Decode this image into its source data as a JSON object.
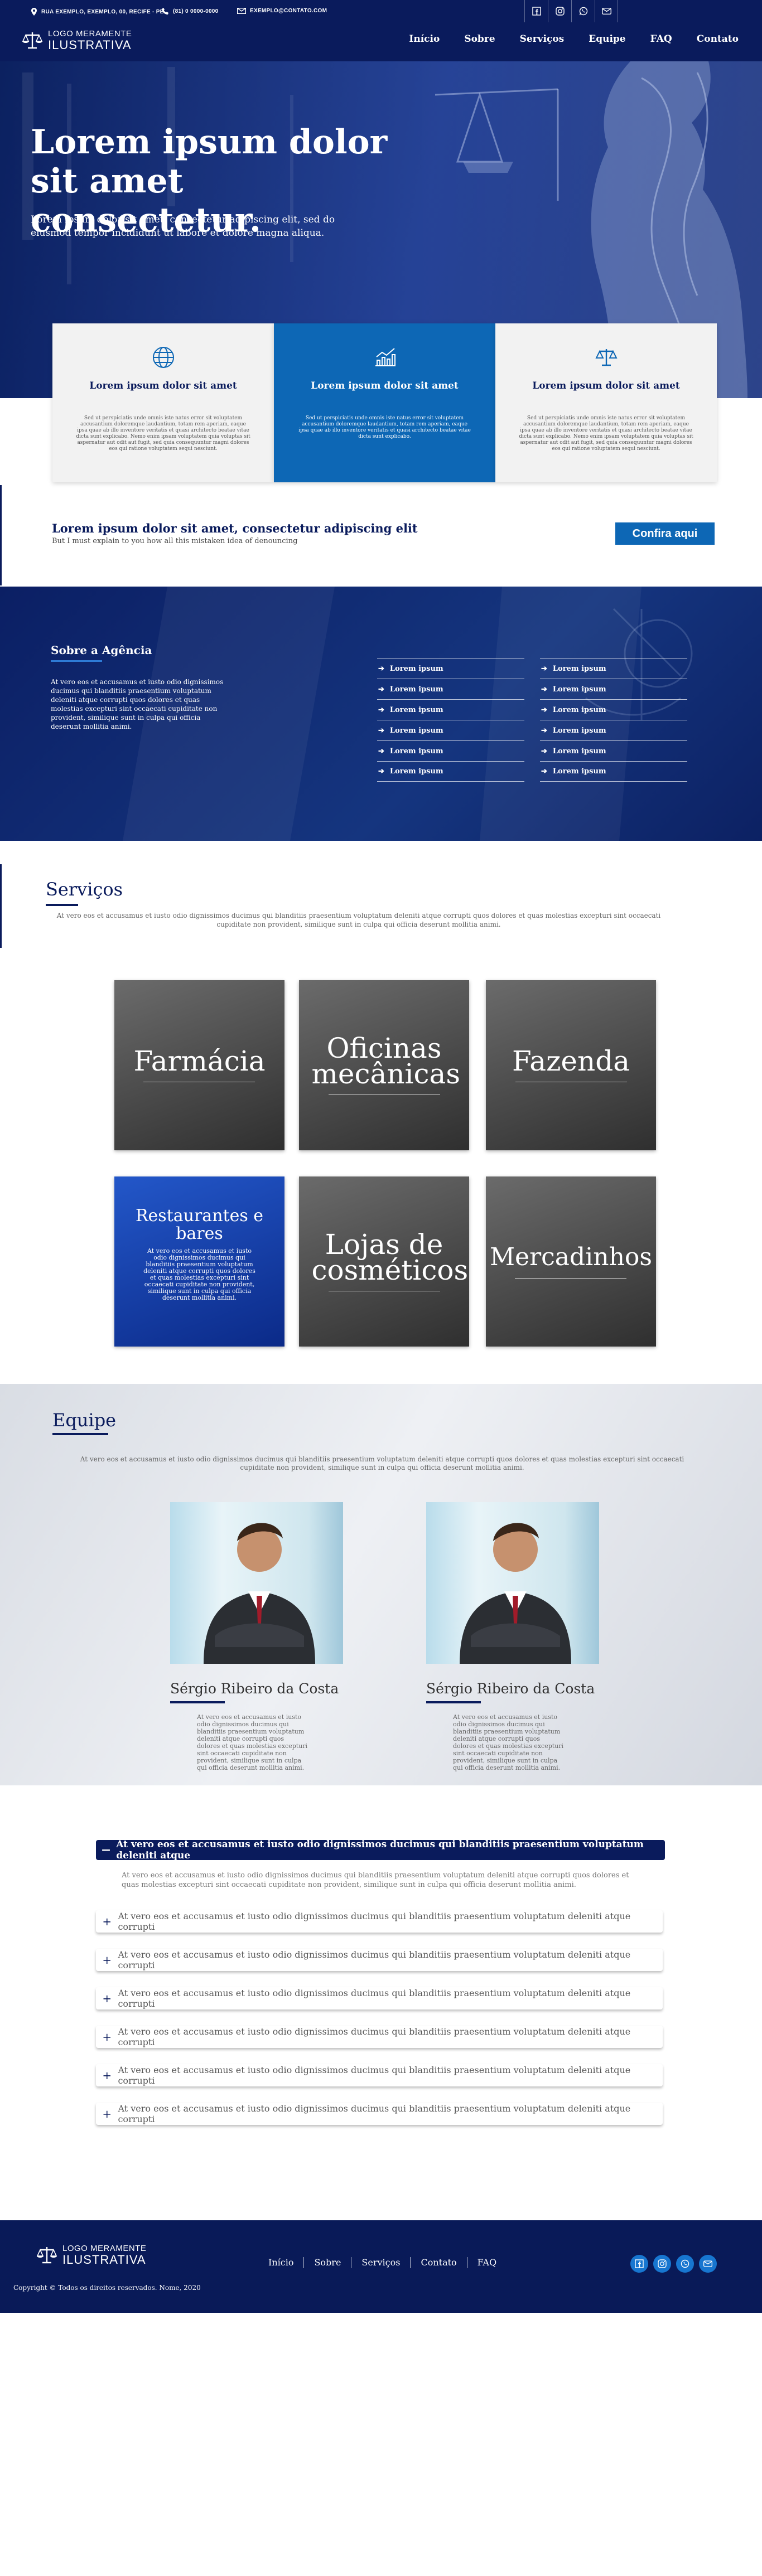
{
  "topbar": {
    "address": "RUA EXEMPLO, EXEMPLO, 00, RECIFE - PE",
    "phone": "(81) 0 0000-0000",
    "email": "EXEMPLO@CONTATO.COM",
    "social_icons": [
      "facebook-icon",
      "instagram-icon",
      "whatsapp-icon",
      "mail-icon"
    ]
  },
  "header": {
    "logo_line1": "LOGO MERAMENTE",
    "logo_line2": "ILUSTRATIVA",
    "nav": [
      "Início",
      "Sobre",
      "Serviços",
      "Equipe",
      "FAQ",
      "Contato"
    ]
  },
  "hero": {
    "title": "Lorem ipsum dolor sit amet consectetur.",
    "subtitle": "Lorem ipsum dolor sit amet, consectetur adipiscing elit, sed do eiusmod tempor incididunt ut labore et dolore magna aliqua."
  },
  "features": [
    {
      "icon": "globe-icon",
      "title": "Lorem ipsum dolor sit amet",
      "text": "Sed ut perspiciatis unde omnis iste natus error sit voluptatem accusantium doloremque laudantium, totam rem aperiam, eaque ipsa quae ab illo inventore veritatis et quasi architecto beatae vitae dicta sunt explicabo. Nemo enim ipsam voluptatem quia voluptas sit aspernatur aut odit aut fugit, sed quia consequuntur magni dolores eos qui ratione voluptatem sequi nesciunt."
    },
    {
      "icon": "chart-icon",
      "title": "Lorem ipsum dolor sit amet",
      "text": "Sed ut perspiciatis unde omnis iste natus error sit voluptatem accusantium doloremque laudantium, totam rem aperiam, eaque ipsa quae ab illo inventore veritatis et quasi architecto beatae vitae dicta sunt explicabo."
    },
    {
      "icon": "scale-icon",
      "title": "Lorem ipsum dolor sit amet",
      "text": "Sed ut perspiciatis unde omnis iste natus error sit voluptatem accusantium doloremque laudantium, totam rem aperiam, eaque ipsa quae ab illo inventore veritatis et quasi architecto beatae vitae dicta sunt explicabo. Nemo enim ipsam voluptatem quia voluptas sit aspernatur aut odit aut fugit, sed quia consequuntur magni dolores eos qui ratione voluptatem sequi nesciunt."
    }
  ],
  "cta": {
    "title": "Lorem ipsum dolor sit amet, consectetur adipiscing elit",
    "text": "But I must explain to you how all this mistaken idea of denouncing",
    "button": "Confira aqui"
  },
  "about": {
    "title": "Sobre a Agência",
    "text": "At vero eos et accusamus et iusto odio dignissimos ducimus qui blanditiis praesentium voluptatum deleniti atque corrupti quos dolores et quas molestias excepturi sint occaecati cupiditate non provident, similique sunt in culpa qui officia deserunt mollitia animi.",
    "list_left": [
      "Lorem ipsum",
      "Lorem ipsum",
      "Lorem ipsum",
      "Lorem ipsum",
      "Lorem ipsum",
      "Lorem ipsum"
    ],
    "list_right": [
      "Lorem ipsum",
      "Lorem ipsum",
      "Lorem ipsum",
      "Lorem ipsum",
      "Lorem ipsum",
      "Lorem ipsum"
    ]
  },
  "services": {
    "title": "Serviços",
    "text": "At vero eos et accusamus et iusto odio dignissimos ducimus qui blanditiis praesentium voluptatum deleniti atque corrupti quos dolores et quas molestias excepturi sint occaecati cupiditate non provident, similique sunt in culpa qui officia deserunt mollitia animi.",
    "cards": [
      {
        "label": "Farmácia"
      },
      {
        "label": "Oficinas mecânicas"
      },
      {
        "label": "Fazenda"
      },
      {
        "label": "Restaurantes e bares",
        "text": "At vero eos et accusamus et iusto odio dignissimos ducimus qui blanditiis praesentium voluptatum deleniti atque corrupti quos dolores et quas molestias excepturi sint occaecati cupiditate non provident, similique sunt in culpa qui officia deserunt mollitia animi."
      },
      {
        "label": "Lojas de cosméticos"
      },
      {
        "label": "Mercadinhos"
      }
    ]
  },
  "team": {
    "title": "Equipe",
    "text": "At vero eos et accusamus et iusto odio dignissimos ducimus qui blanditiis praesentium voluptatum deleniti atque corrupti quos dolores et quas molestias excepturi sint occaecati cupiditate non provident, similique sunt in culpa qui officia deserunt mollitia animi.",
    "members": [
      {
        "name": "Sérgio Ribeiro da Costa",
        "text": "At vero eos et accusamus et iusto odio dignissimos ducimus qui blanditiis praesentium voluptatum deleniti atque corrupti quos dolores et quas molestias excepturi sint occaecati cupiditate non provident, similique sunt in culpa qui officia deserunt mollitia animi."
      },
      {
        "name": "Sérgio Ribeiro da Costa",
        "text": "At vero eos et accusamus et iusto odio dignissimos ducimus qui blanditiis praesentium voluptatum deleniti atque corrupti quos dolores et quas molestias excepturi sint occaecati cupiditate non provident, similique sunt in culpa qui officia deserunt mollitia animi."
      }
    ]
  },
  "faq": {
    "active_question": "At vero eos et accusamus et iusto odio dignissimos ducimus qui blanditiis praesentium voluptatum deleniti atque",
    "active_answer": "At vero eos et accusamus et iusto odio dignissimos ducimus qui blanditiis praesentium voluptatum deleniti atque corrupti quos dolores et quas molestias excepturi sint occaecati cupiditate non provident, similique sunt in culpa qui officia deserunt mollitia animi.",
    "questions": [
      "At vero eos et accusamus et iusto odio dignissimos ducimus qui blanditiis praesentium voluptatum deleniti atque corrupti",
      "At vero eos et accusamus et iusto odio dignissimos ducimus qui blanditiis praesentium voluptatum deleniti atque corrupti",
      "At vero eos et accusamus et iusto odio dignissimos ducimus qui blanditiis praesentium voluptatum deleniti atque corrupti",
      "At vero eos et accusamus et iusto odio dignissimos ducimus qui blanditiis praesentium voluptatum deleniti atque corrupti",
      "At vero eos et accusamus et iusto odio dignissimos ducimus qui blanditiis praesentium voluptatum deleniti atque corrupti",
      "At vero eos et accusamus et iusto odio dignissimos ducimus qui blanditiis praesentium voluptatum deleniti atque corrupti"
    ]
  },
  "footer": {
    "logo_line1": "LOGO MERAMENTE",
    "logo_line2": "ILUSTRATIVA",
    "nav": [
      "Início",
      "Sobre",
      "Serviços",
      "Contato",
      "FAQ"
    ],
    "social_icons": [
      "facebook-icon",
      "instagram-icon",
      "whatsapp-icon",
      "mail-icon"
    ],
    "copyright": "Copyright © Todos os direitos reservados. Nome, 2020"
  },
  "colors": {
    "navy": "#0a1b5c",
    "accent_blue": "#0d67b5",
    "hero_blue": "#16358f"
  }
}
